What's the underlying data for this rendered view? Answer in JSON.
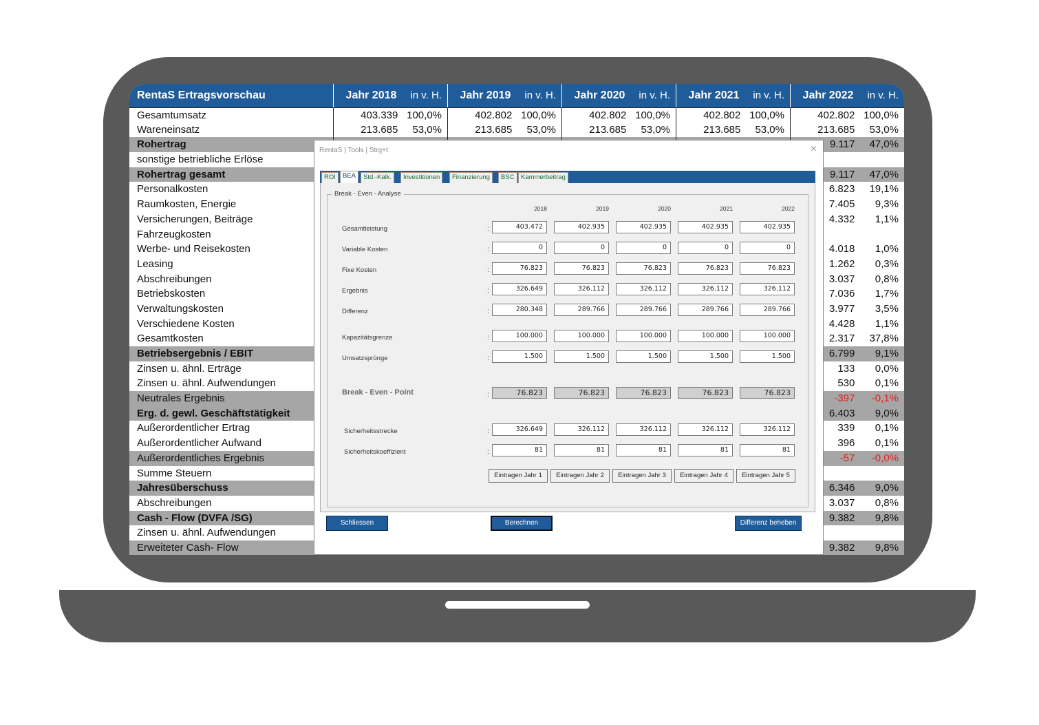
{
  "sheet": {
    "title": "RentaS Ertragsvorschau",
    "years": [
      {
        "label": "Jahr 2018",
        "pct": "in v. H."
      },
      {
        "label": "Jahr 2019",
        "pct": "in v. H."
      },
      {
        "label": "Jahr 2020",
        "pct": "in v. H."
      },
      {
        "label": "Jahr 2021",
        "pct": "in v. H."
      },
      {
        "label": "Jahr 2022",
        "pct": "in v. H."
      }
    ],
    "rows": [
      {
        "label": "Gesamtumsatz",
        "style": "first",
        "cells": [
          [
            "403.339",
            "100,0%"
          ],
          [
            "402.802",
            "100,0%"
          ],
          [
            "402.802",
            "100,0%"
          ],
          [
            "402.802",
            "100,0%"
          ],
          [
            "402.802",
            "100,0%"
          ]
        ]
      },
      {
        "label": "Wareneinsatz",
        "style": "",
        "cells": [
          [
            "213.685",
            "53,0%"
          ],
          [
            "213.685",
            "53,0%"
          ],
          [
            "213.685",
            "53,0%"
          ],
          [
            "213.685",
            "53,0%"
          ],
          [
            "213.685",
            "53,0%"
          ]
        ]
      },
      {
        "label": "Rohertrag",
        "style": "gray bold",
        "cells": [
          [
            "",
            ""
          ],
          [
            "",
            ""
          ],
          [
            "",
            ""
          ],
          [
            "",
            ""
          ],
          [
            "9.117",
            "47,0%"
          ]
        ]
      },
      {
        "label": "sonstige betriebliche Erlöse",
        "style": "",
        "cells": [
          [
            "",
            ""
          ],
          [
            "",
            ""
          ],
          [
            "",
            ""
          ],
          [
            "",
            ""
          ],
          [
            "",
            ""
          ]
        ]
      },
      {
        "label": "Rohertrag gesamt",
        "style": "gray bold",
        "cells": [
          [
            "",
            ""
          ],
          [
            "",
            ""
          ],
          [
            "",
            ""
          ],
          [
            "",
            ""
          ],
          [
            "9.117",
            "47,0%"
          ]
        ]
      },
      {
        "label": "Personalkosten",
        "style": "",
        "cells": [
          [
            "",
            ""
          ],
          [
            "",
            ""
          ],
          [
            "",
            ""
          ],
          [
            "",
            ""
          ],
          [
            "6.823",
            "19,1%"
          ]
        ]
      },
      {
        "label": "Raumkosten,  Energie",
        "style": "",
        "cells": [
          [
            "",
            ""
          ],
          [
            "",
            ""
          ],
          [
            "",
            ""
          ],
          [
            "",
            ""
          ],
          [
            "7.405",
            "9,3%"
          ]
        ]
      },
      {
        "label": "Versicherungen, Beiträge",
        "style": "",
        "cells": [
          [
            "",
            ""
          ],
          [
            "",
            ""
          ],
          [
            "",
            ""
          ],
          [
            "",
            ""
          ],
          [
            "4.332",
            "1,1%"
          ]
        ]
      },
      {
        "label": "Fahrzeugkosten",
        "style": "",
        "cells": [
          [
            "",
            ""
          ],
          [
            "",
            ""
          ],
          [
            "",
            ""
          ],
          [
            "",
            ""
          ],
          [
            "",
            ""
          ]
        ]
      },
      {
        "label": "Werbe- und Reisekosten",
        "style": "",
        "cells": [
          [
            "",
            ""
          ],
          [
            "",
            ""
          ],
          [
            "",
            ""
          ],
          [
            "",
            ""
          ],
          [
            "4.018",
            "1,0%"
          ]
        ]
      },
      {
        "label": "Leasing",
        "style": "",
        "cells": [
          [
            "",
            ""
          ],
          [
            "",
            ""
          ],
          [
            "",
            ""
          ],
          [
            "",
            ""
          ],
          [
            "1.262",
            "0,3%"
          ]
        ]
      },
      {
        "label": "Abschreibungen",
        "style": "",
        "cells": [
          [
            "",
            ""
          ],
          [
            "",
            ""
          ],
          [
            "",
            ""
          ],
          [
            "",
            ""
          ],
          [
            "3.037",
            "0,8%"
          ]
        ]
      },
      {
        "label": "Betriebskosten",
        "style": "",
        "cells": [
          [
            "",
            ""
          ],
          [
            "",
            ""
          ],
          [
            "",
            ""
          ],
          [
            "",
            ""
          ],
          [
            "7.036",
            "1,7%"
          ]
        ]
      },
      {
        "label": "Verwaltungskosten",
        "style": "",
        "cells": [
          [
            "",
            ""
          ],
          [
            "",
            ""
          ],
          [
            "",
            ""
          ],
          [
            "",
            ""
          ],
          [
            "3.977",
            "3,5%"
          ]
        ]
      },
      {
        "label": "Verschiedene Kosten",
        "style": "",
        "cells": [
          [
            "",
            ""
          ],
          [
            "",
            ""
          ],
          [
            "",
            ""
          ],
          [
            "",
            ""
          ],
          [
            "4.428",
            "1,1%"
          ]
        ]
      },
      {
        "label": "Gesamtkosten",
        "style": "",
        "cells": [
          [
            "",
            ""
          ],
          [
            "",
            ""
          ],
          [
            "",
            ""
          ],
          [
            "",
            ""
          ],
          [
            "2.317",
            "37,8%"
          ]
        ]
      },
      {
        "label": "Betriebsergebnis / EBIT",
        "style": "gray bold",
        "cells": [
          [
            "",
            ""
          ],
          [
            "",
            ""
          ],
          [
            "",
            ""
          ],
          [
            "",
            ""
          ],
          [
            "6.799",
            "9,1%"
          ]
        ]
      },
      {
        "label": "Zinsen u. ähnl. Erträge",
        "style": "",
        "cells": [
          [
            "",
            ""
          ],
          [
            "",
            ""
          ],
          [
            "",
            ""
          ],
          [
            "",
            ""
          ],
          [
            "133",
            "0,0%"
          ]
        ]
      },
      {
        "label": "Zinsen u. ähnl. Aufwendungen",
        "style": "",
        "cells": [
          [
            "",
            ""
          ],
          [
            "",
            ""
          ],
          [
            "",
            ""
          ],
          [
            "",
            ""
          ],
          [
            "530",
            "0,1%"
          ]
        ]
      },
      {
        "label": "Neutrales Ergebnis",
        "style": "gray",
        "neg": true,
        "cells": [
          [
            "",
            ""
          ],
          [
            "",
            ""
          ],
          [
            "",
            ""
          ],
          [
            "",
            ""
          ],
          [
            "-397",
            "-0,1%"
          ]
        ]
      },
      {
        "label": "Erg. d. gewl. Geschäftstätigkeit",
        "style": "gray bold",
        "cells": [
          [
            "",
            ""
          ],
          [
            "",
            ""
          ],
          [
            "",
            ""
          ],
          [
            "",
            ""
          ],
          [
            "6.403",
            "9,0%"
          ]
        ]
      },
      {
        "label": "Außerordentlicher Ertrag",
        "style": "",
        "cells": [
          [
            "",
            ""
          ],
          [
            "",
            ""
          ],
          [
            "",
            ""
          ],
          [
            "",
            ""
          ],
          [
            "339",
            "0,1%"
          ]
        ]
      },
      {
        "label": "Außerordentlicher Aufwand",
        "style": "",
        "cells": [
          [
            "",
            ""
          ],
          [
            "",
            ""
          ],
          [
            "",
            ""
          ],
          [
            "",
            ""
          ],
          [
            "396",
            "0,1%"
          ]
        ]
      },
      {
        "label": "Außerordentliches Ergebnis",
        "style": "gray",
        "neg": true,
        "cells": [
          [
            "",
            ""
          ],
          [
            "",
            ""
          ],
          [
            "",
            ""
          ],
          [
            "",
            ""
          ],
          [
            "-57",
            "-0,0%"
          ]
        ]
      },
      {
        "label": "Summe Steuern",
        "style": "",
        "cells": [
          [
            "",
            ""
          ],
          [
            "",
            ""
          ],
          [
            "",
            ""
          ],
          [
            "",
            ""
          ],
          [
            "",
            ""
          ]
        ]
      },
      {
        "label": "Jahresüberschuss",
        "style": "gray bold",
        "cells": [
          [
            "",
            ""
          ],
          [
            "",
            ""
          ],
          [
            "",
            ""
          ],
          [
            "",
            ""
          ],
          [
            "6.346",
            "9,0%"
          ]
        ]
      },
      {
        "label": "Abschreibungen",
        "style": "",
        "cells": [
          [
            "",
            ""
          ],
          [
            "",
            ""
          ],
          [
            "",
            ""
          ],
          [
            "",
            ""
          ],
          [
            "3.037",
            "0,8%"
          ]
        ]
      },
      {
        "label": "Cash - Flow (DVFA /SG)",
        "style": "gray bold",
        "cells": [
          [
            "",
            ""
          ],
          [
            "",
            ""
          ],
          [
            "",
            ""
          ],
          [
            "",
            ""
          ],
          [
            "9.382",
            "9,8%"
          ]
        ]
      },
      {
        "label": "Zinsen u. ähnl. Aufwendungen",
        "style": "",
        "cells": [
          [
            "",
            ""
          ],
          [
            "",
            ""
          ],
          [
            "",
            ""
          ],
          [
            "",
            ""
          ],
          [
            "",
            ""
          ]
        ]
      },
      {
        "label": "Erweiteter Cash- Flow",
        "style": "gray",
        "cells": [
          [
            "",
            ""
          ],
          [
            "",
            ""
          ],
          [
            "",
            ""
          ],
          [
            "",
            ""
          ],
          [
            "9.382",
            "9,8%"
          ]
        ]
      }
    ]
  },
  "dialog": {
    "title": "RentaS | Tools | Strg+t",
    "close": "×",
    "tabs": [
      "ROI",
      "BEA",
      "Std.-Kalk.",
      "Investitionen",
      "Finanzierung",
      "BSC",
      "Kammerbeitrag"
    ],
    "active_tab": "BEA",
    "group_title": "Break - Even - Analyse",
    "years": [
      "2018",
      "2019",
      "2020",
      "2021",
      "2022"
    ],
    "colon": ":",
    "rows": [
      {
        "label": "Gesamtleistung",
        "values": [
          "403.472",
          "402.935",
          "402.935",
          "402.935",
          "402.935"
        ]
      },
      {
        "label": "Variable Kosten",
        "values": [
          "0",
          "0",
          "0",
          "0",
          "0"
        ]
      },
      {
        "label": "Fixe Kosten",
        "values": [
          "76.823",
          "76.823",
          "76.823",
          "76.823",
          "76.823"
        ]
      },
      {
        "label": "Ergebnis",
        "values": [
          "326.649",
          "326.112",
          "326.112",
          "326.112",
          "326.112"
        ]
      },
      {
        "label": "Differenz",
        "values": [
          "280.348",
          "289.766",
          "289.766",
          "289.766",
          "289.766"
        ]
      },
      {
        "label": "Kapazitätsgrenze",
        "values": [
          "100.000",
          "100.000",
          "100.000",
          "100.000",
          "100.000"
        ]
      },
      {
        "label": "Umsatzsprünge",
        "values": [
          "1.500",
          "1.500",
          "1.500",
          "1.500",
          "1.500"
        ]
      },
      {
        "label": "Break - Even - Point",
        "values": [
          "76.823",
          "76.823",
          "76.823",
          "76.823",
          "76.823"
        ]
      },
      {
        "label": "Sicherheitsstrecke",
        "values": [
          "326.649",
          "326.112",
          "326.112",
          "326.112",
          "326.112"
        ]
      },
      {
        "label": "Sicherheitskoeffizient",
        "values": [
          "81",
          "81",
          "81",
          "81",
          "81"
        ]
      }
    ],
    "enter_buttons": [
      "Eintragen Jahr 1",
      "Eintragen Jahr 2",
      "Eintragen Jahr 3",
      "Eintragen Jahr 4",
      "Eintragen Jahr 5"
    ],
    "close_button": "Schliessen",
    "calc_button": "Berechnen",
    "diff_button": "Differenz beheben"
  }
}
